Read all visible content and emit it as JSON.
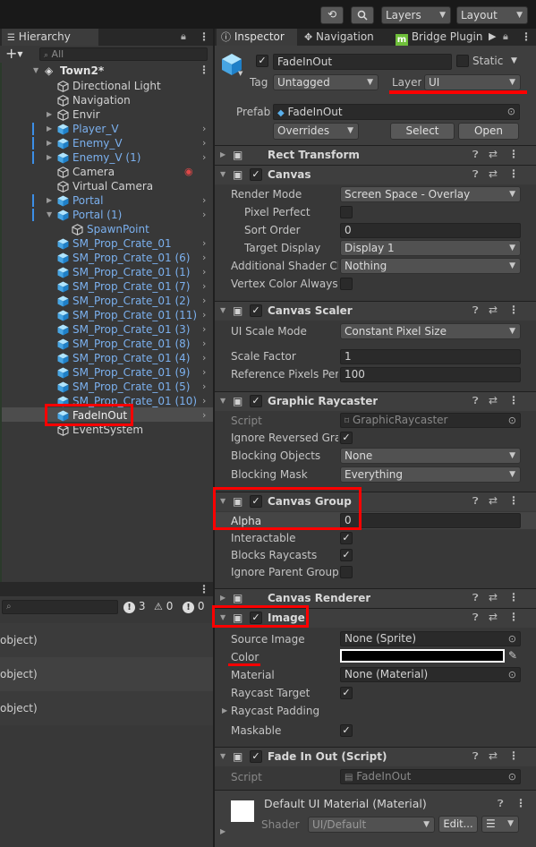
{
  "toolbar": {
    "layers_label": "Layers",
    "layout_label": "Layout"
  },
  "hierarchy": {
    "tab_label": "Hierarchy",
    "search_placeholder": "All",
    "scene_name": "Town2*",
    "items": [
      {
        "label": "Directional Light"
      },
      {
        "label": "Navigation"
      },
      {
        "label": "Envir"
      },
      {
        "label": "Player_V"
      },
      {
        "label": "Enemy_V"
      },
      {
        "label": "Enemy_V (1)"
      },
      {
        "label": "Camera"
      },
      {
        "label": "Virtual Camera"
      },
      {
        "label": "Portal"
      },
      {
        "label": "Portal (1)"
      },
      {
        "label": "SpawnPoint"
      },
      {
        "label": "SM_Prop_Crate_01"
      },
      {
        "label": "SM_Prop_Crate_01 (6)"
      },
      {
        "label": "SM_Prop_Crate_01 (1)"
      },
      {
        "label": "SM_Prop_Crate_01 (7)"
      },
      {
        "label": "SM_Prop_Crate_01 (2)"
      },
      {
        "label": "SM_Prop_Crate_01 (11)"
      },
      {
        "label": "SM_Prop_Crate_01 (3)"
      },
      {
        "label": "SM_Prop_Crate_01 (8)"
      },
      {
        "label": "SM_Prop_Crate_01 (4)"
      },
      {
        "label": "SM_Prop_Crate_01 (9)"
      },
      {
        "label": "SM_Prop_Crate_01 (5)"
      },
      {
        "label": "SM_Prop_Crate_01 (10)"
      },
      {
        "label": "FadeInOut"
      },
      {
        "label": "EventSystem"
      }
    ]
  },
  "console": {
    "count_warn": "3",
    "count_error": "0",
    "count_info": "0",
    "rows": [
      "object)",
      "object)",
      "object)"
    ]
  },
  "inspector": {
    "tabs": [
      "Inspector",
      "Navigation",
      "Bridge Plugin"
    ],
    "object_name": "FadeInOut",
    "static_label": "Static",
    "tag_label": "Tag",
    "tag_value": "Untagged",
    "layer_label": "Layer",
    "layer_value": "UI",
    "prefab_label": "Prefab",
    "prefab_value": "FadeInOut",
    "overrides_label": "Overrides",
    "select_label": "Select",
    "open_label": "Open",
    "rect_transform": "Rect Transform",
    "canvas": {
      "title": "Canvas",
      "render_mode_label": "Render Mode",
      "render_mode_value": "Screen Space - Overlay",
      "pixel_perfect_label": "Pixel Perfect",
      "sort_order_label": "Sort Order",
      "sort_order_value": "0",
      "target_display_label": "Target Display",
      "target_display_value": "Display 1",
      "additional_shader_label": "Additional Shader Ch",
      "additional_shader_value": "Nothing",
      "vertex_color_label": "Vertex Color Always I"
    },
    "canvas_scaler": {
      "title": "Canvas Scaler",
      "ui_scale_label": "UI Scale Mode",
      "ui_scale_value": "Constant Pixel Size",
      "scale_factor_label": "Scale Factor",
      "scale_factor_value": "1",
      "ref_ppu_label": "Reference Pixels Per",
      "ref_ppu_value": "100"
    },
    "graphic_raycaster": {
      "title": "Graphic Raycaster",
      "script_label": "Script",
      "script_value": "GraphicRaycaster",
      "ignore_reversed_label": "Ignore Reversed Grap",
      "blocking_objects_label": "Blocking Objects",
      "blocking_objects_value": "None",
      "blocking_mask_label": "Blocking Mask",
      "blocking_mask_value": "Everything"
    },
    "canvas_group": {
      "title": "Canvas Group",
      "alpha_label": "Alpha",
      "alpha_value": "0",
      "interactable_label": "Interactable",
      "blocks_raycasts_label": "Blocks Raycasts",
      "ignore_parent_label": "Ignore Parent Groups"
    },
    "canvas_renderer": "Canvas Renderer",
    "image": {
      "title": "Image",
      "source_image_label": "Source Image",
      "source_image_value": "None (Sprite)",
      "color_label": "Color",
      "color_value": "#000000",
      "material_label": "Material",
      "material_value": "None (Material)",
      "raycast_target_label": "Raycast Target",
      "raycast_padding_label": "Raycast Padding",
      "maskable_label": "Maskable"
    },
    "fade_script": {
      "title": "Fade In Out (Script)",
      "script_label": "Script",
      "script_value": "FadeInOut"
    },
    "material": {
      "title": "Default UI Material (Material)",
      "shader_label": "Shader",
      "shader_value": "UI/Default",
      "edit_label": "Edit..."
    }
  },
  "colors": {
    "highlight": "#ff0000",
    "prefab_blue": "#7bb0ee"
  }
}
